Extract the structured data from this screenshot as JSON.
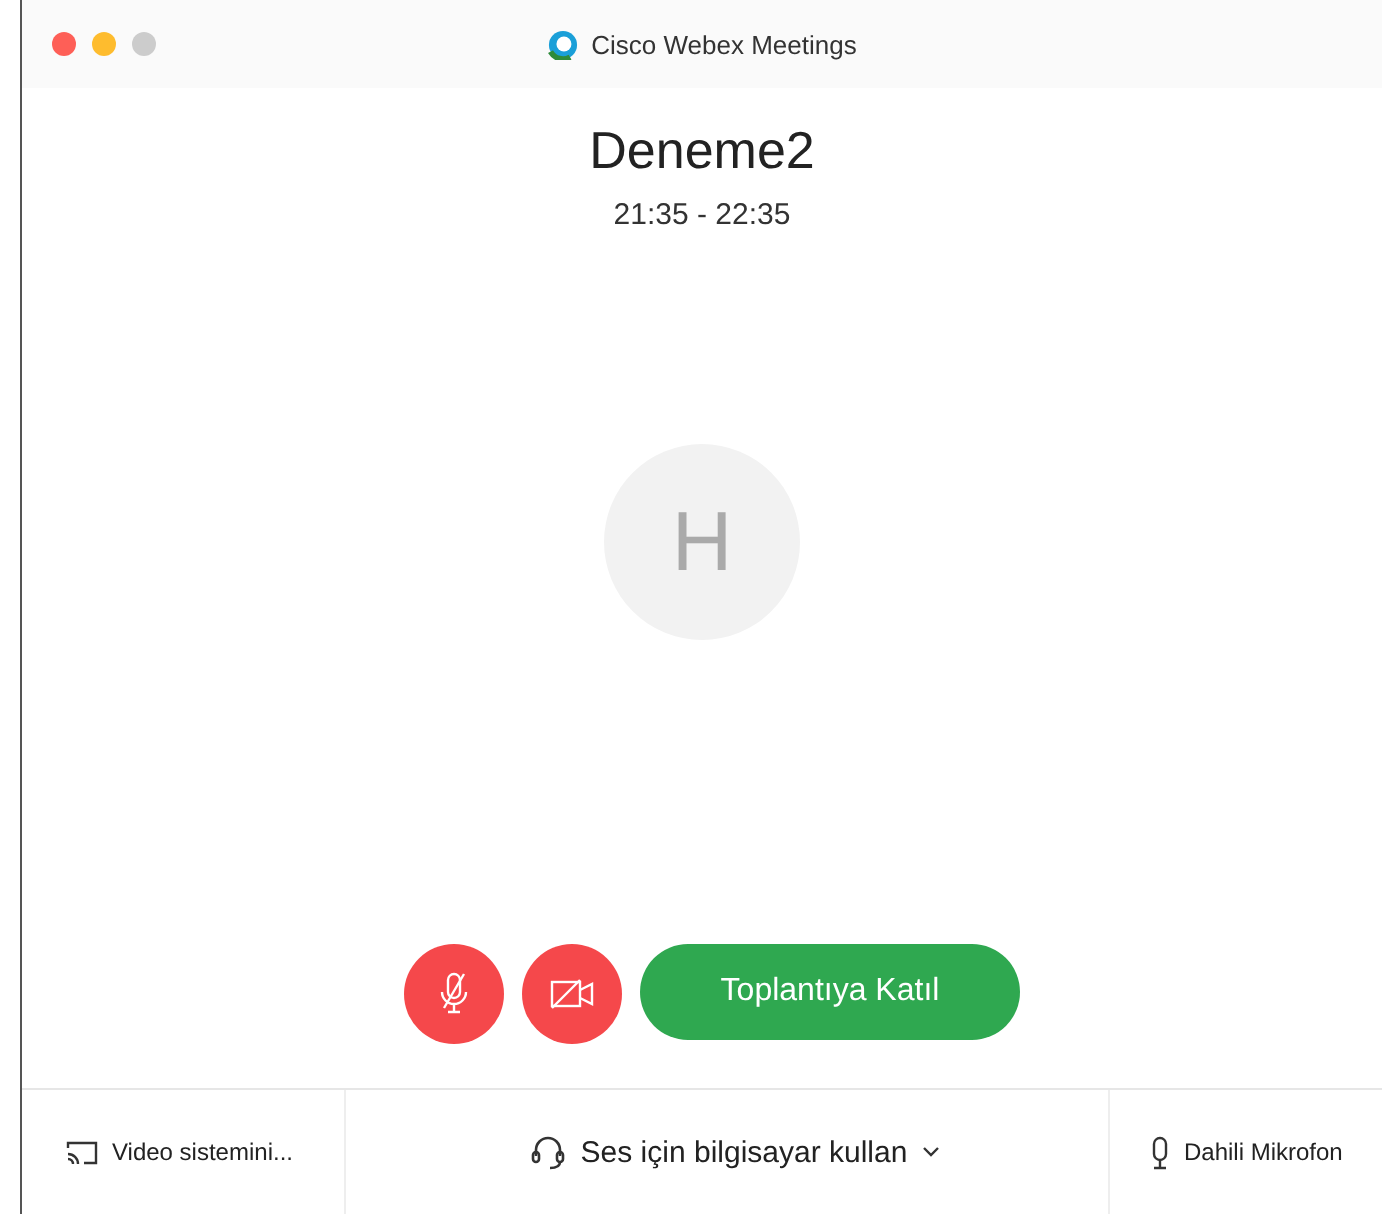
{
  "window": {
    "title": "Cisco Webex Meetings"
  },
  "meeting": {
    "title": "Deneme2",
    "time": "21:35 - 22:35",
    "avatar_initial": "H"
  },
  "controls": {
    "muted": true,
    "video_off": true,
    "join_label": "Toplantıya Katıl"
  },
  "footer": {
    "video_system": "Video sistemini...",
    "audio": "Ses için bilgisayar kullan",
    "microphone": "Dahili Mikrofon"
  }
}
